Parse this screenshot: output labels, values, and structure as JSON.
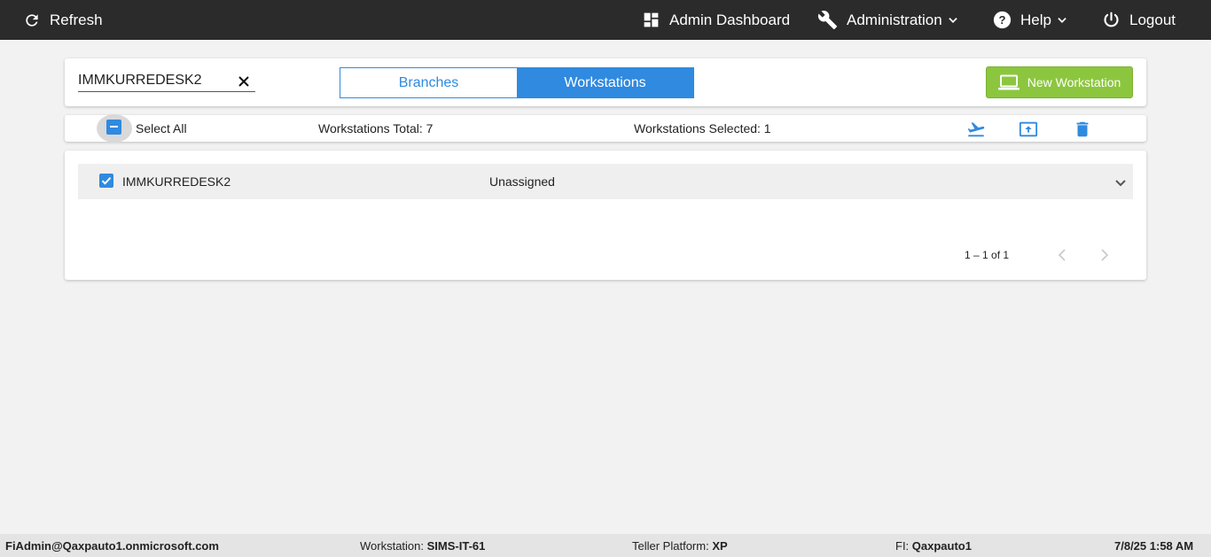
{
  "topbar": {
    "refresh_label": "Refresh",
    "dashboard_label": "Admin Dashboard",
    "administration_label": "Administration",
    "help_label": "Help",
    "logout_label": "Logout"
  },
  "filter": {
    "search_value": "IMMKURREDESK2",
    "tabs": [
      {
        "label": "Branches",
        "active": false
      },
      {
        "label": "Workstations",
        "active": true
      }
    ],
    "new_button_label": "New Workstation"
  },
  "toolbar": {
    "select_all_label": "Select All",
    "total_text": "Workstations Total: 7",
    "selected_text": "Workstations Selected: 1"
  },
  "list": {
    "rows": [
      {
        "name": "IMMKURREDESK2",
        "status": "Unassigned",
        "checked": true
      }
    ],
    "pager_range": "1 – 1 of 1"
  },
  "footer": {
    "user": "FiAdmin@Qaxpauto1.onmicrosoft.com",
    "workstation_label": "Workstation: ",
    "workstation_value": "SIMS-IT-61",
    "teller_label": "Teller Platform: ",
    "teller_value": "XP",
    "fi_label": "FI: ",
    "fi_value": "Qaxpauto1",
    "datetime": "7/8/25 1:58 AM"
  },
  "colors": {
    "topbar_bg": "#2b2b2b",
    "accent_blue": "#2f8ae0",
    "new_button_green": "#8cc63f",
    "page_bg": "#f2f2f2"
  }
}
